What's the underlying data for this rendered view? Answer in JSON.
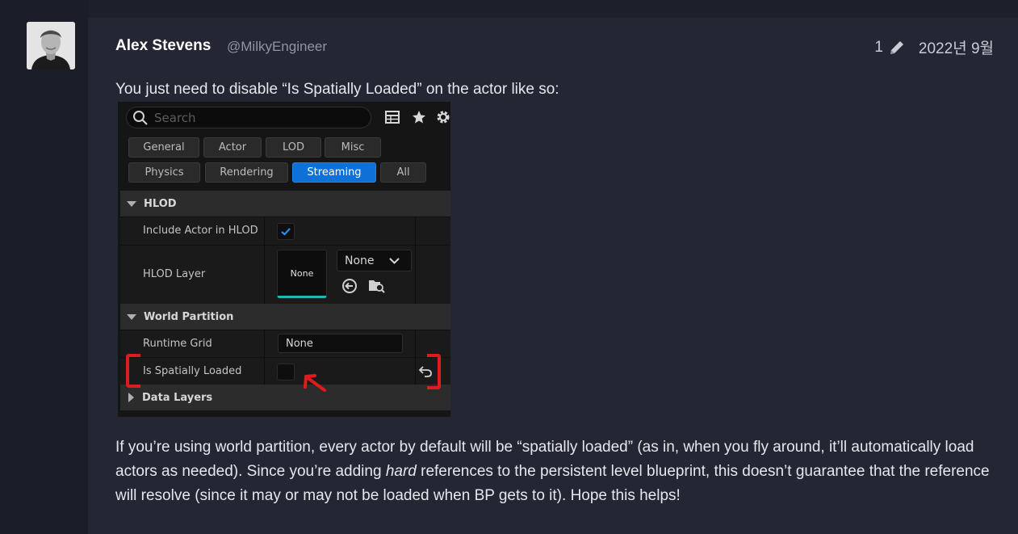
{
  "post": {
    "author_name": "Alex Stevens",
    "author_handle": "@MilkyEngineer",
    "edit_count": "1",
    "date": "2022년 9월",
    "intro": "You just need to disable “Is Spatially Loaded” on the actor like so:",
    "para_1": "If you’re using world partition, every actor by default will be “spatially loaded” (as in, when you fly around, it’ll automatically load actors as needed). Since you’re adding ",
    "para_em": "hard",
    "para_2": " references to the persistent level blueprint, this doesn’t guarantee that the reference will resolve (since it may or may not be loaded when BP gets to it). Hope this helps!"
  },
  "editor": {
    "search_placeholder": "Search",
    "tabs_row1": [
      "General",
      "Actor",
      "LOD",
      "Misc"
    ],
    "tabs_row2": [
      "Physics",
      "Rendering",
      "Streaming",
      "All"
    ],
    "section_hlod": "HLOD",
    "include_actor_label": "Include Actor in HLOD",
    "include_actor_checked": true,
    "hlod_layer_label": "HLOD Layer",
    "hlod_thumb": "None",
    "hlod_combo": "None",
    "section_wp": "World Partition",
    "runtime_grid_label": "Runtime Grid",
    "runtime_grid_value": "None",
    "spatially_loaded_label": "Is Spatially Loaded",
    "spatially_loaded_checked": false,
    "section_data_layers": "Data Layers",
    "accent_color": "#0f70d8",
    "annotation_color": "#e01b1b"
  }
}
